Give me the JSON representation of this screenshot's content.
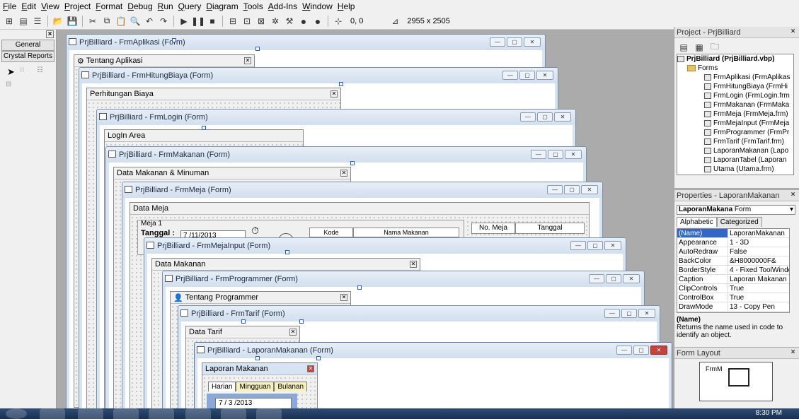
{
  "menu": [
    "File",
    "Edit",
    "View",
    "Project",
    "Format",
    "Debug",
    "Run",
    "Query",
    "Diagram",
    "Tools",
    "Add-Ins",
    "Window",
    "Help"
  ],
  "toolbar": {
    "coords": "0, 0",
    "size": "2955 x 2505"
  },
  "toolbox": {
    "close": "×",
    "tab_general": "General",
    "tab_crystal": "Crystal Reports"
  },
  "window_buttons": {
    "min": "—",
    "max": "▢",
    "close": "✕"
  },
  "windows": [
    {
      "id": "frmaplikasi",
      "title": "PrjBilliard - FrmAplikasi (Form)",
      "inner": "Tentang Aplikasi"
    },
    {
      "id": "frmhitungbiaya",
      "title": "PrjBilliard - FrmHitungBiaya (Form)",
      "inner": "Perhitungan Biaya"
    },
    {
      "id": "frmlogin",
      "title": "PrjBilliard - FrmLogin (Form)",
      "inner": "LogIn Area"
    },
    {
      "id": "frmmakanan",
      "title": "PrjBilliard - FrmMakanan (Form)",
      "inner": "Data Makanan & Minuman"
    },
    {
      "id": "frmmeja",
      "title": "PrjBilliard - FrmMeja (Form)",
      "inner": "Data Meja"
    },
    {
      "id": "frmmejainput",
      "title": "PrjBilliard - FrmMejaInput (Form)",
      "inner": "Data Makanan"
    },
    {
      "id": "frmprogrammer",
      "title": "PrjBilliard - FrmProgrammer (Form)",
      "inner": "Tentang Programmer"
    },
    {
      "id": "frmtarif",
      "title": "PrjBilliard - FrmTarif (Form)",
      "inner": "Data Tarif"
    },
    {
      "id": "laporanmakanan",
      "title": "PrjBilliard - LaporanMakanan (Form)",
      "inner": "Laporan Makanan"
    }
  ],
  "frmmeja_content": {
    "meja_label": "Meja 1",
    "tanggal_label": "Tanggal :",
    "tanggal_value": "7 /11/2013",
    "col_kode": "Kode Makanan",
    "col_nama": "Nama Makanan",
    "col_nomeja": "No. Meja",
    "col_tanggal": "Tanggal"
  },
  "laporan_content": {
    "tabs": [
      "Harian",
      "Mingguan",
      "Bulanan"
    ],
    "date": "7 / 3 /2013"
  },
  "project": {
    "title": "Project - PrjBilliard",
    "close": "×",
    "root": "PrjBilliard (PrjBilliard.vbp)",
    "folder": "Forms",
    "items": [
      "FrmAplikasi (FrmAplikas",
      "FrmHitungBiaya (FrmHi",
      "FrmLogin (FrmLogin.frm",
      "FrmMakanan (FrmMaka",
      "FrmMeja (FrmMeja.frm)",
      "FrmMejaInput (FrmMeja",
      "FrmProgrammer (FrmPr",
      "FrmTarif (FrmTarif.frm)",
      "LaporanMakanan (Lapo",
      "LaporanTabel (Laporan",
      "Utama (Utama.frm)"
    ]
  },
  "properties": {
    "title": "Properties - LaporanMakanan",
    "close": "×",
    "object": "LaporanMakana",
    "object_type": "Form",
    "tab_alpha": "Alphabetic",
    "tab_cat": "Categorized",
    "rows": [
      {
        "k": "(Name)",
        "v": "LaporanMakanan"
      },
      {
        "k": "Appearance",
        "v": "1 - 3D"
      },
      {
        "k": "AutoRedraw",
        "v": "False"
      },
      {
        "k": "BackColor",
        "v": "&H8000000F&"
      },
      {
        "k": "BorderStyle",
        "v": "4 - Fixed ToolWindo"
      },
      {
        "k": "Caption",
        "v": "Laporan Makanan"
      },
      {
        "k": "ClipControls",
        "v": "True"
      },
      {
        "k": "ControlBox",
        "v": "True"
      },
      {
        "k": "DrawMode",
        "v": "13 - Copy Pen"
      }
    ],
    "desc_title": "(Name)",
    "desc_text": "Returns the name used in code to identify an object."
  },
  "form_layout": {
    "title": "Form Layout",
    "close": "×",
    "label": "FrmM"
  },
  "taskbar": {
    "time": "8:30 PM"
  }
}
